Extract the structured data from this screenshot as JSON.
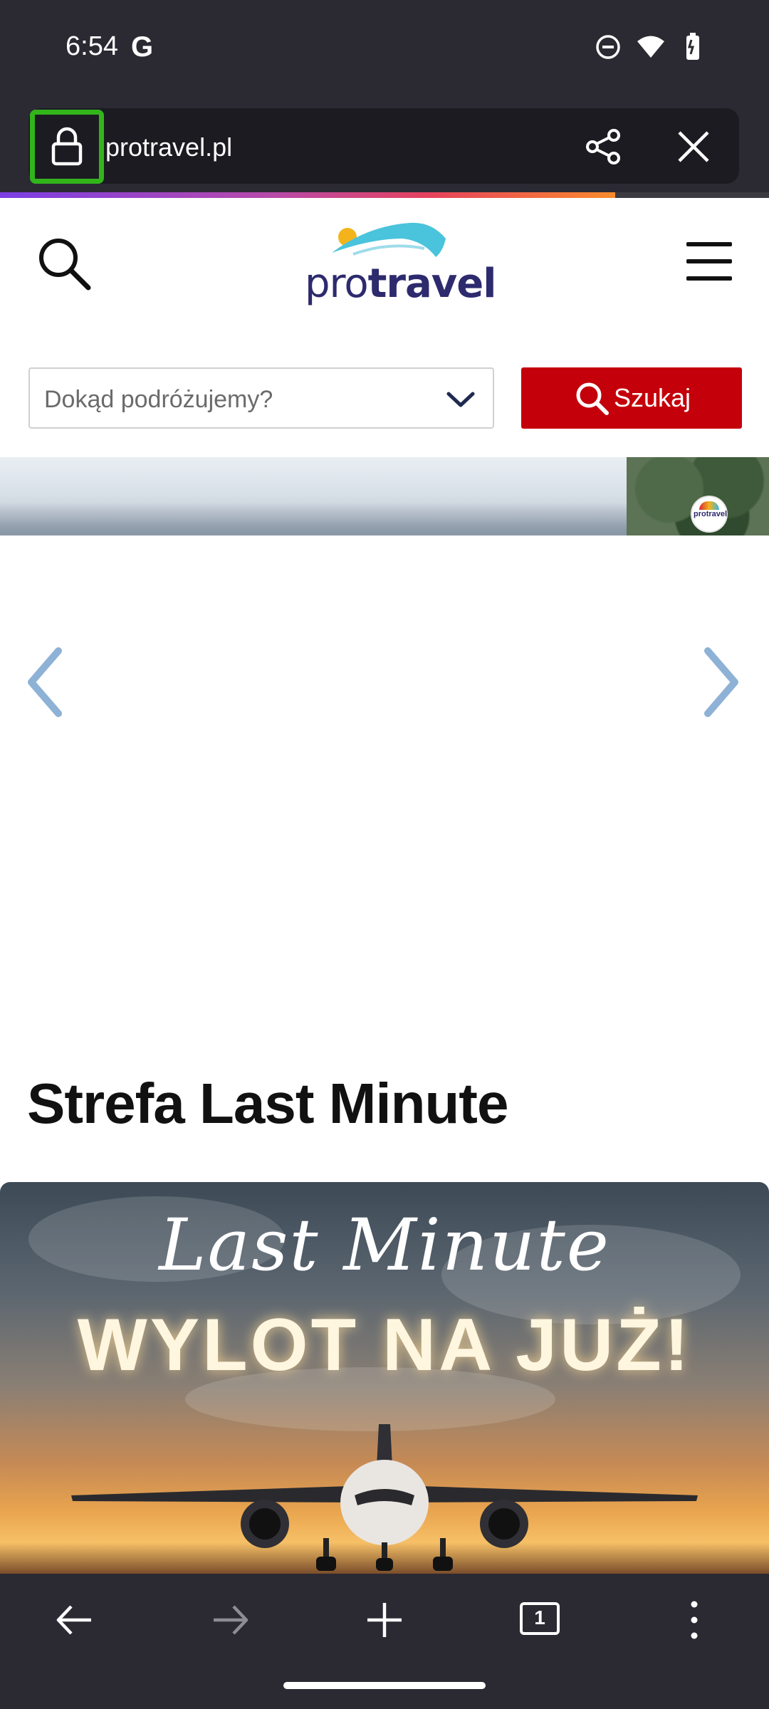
{
  "status_bar": {
    "time": "6:54",
    "google_badge": "G",
    "icons": [
      "do-not-disturb-icon",
      "wifi-icon",
      "battery-icon"
    ]
  },
  "browser": {
    "url": "protravel.pl",
    "load_progress": 0.8,
    "toolbar": {
      "tabs_count": "1",
      "icons": [
        "back-arrow-icon",
        "forward-arrow-icon",
        "new-tab-plus-icon",
        "tabs-counter-icon",
        "more-menu-icon"
      ]
    },
    "accent_colors": {
      "lock_highlight": "#32b41b",
      "chrome_bg": "#2b2a33"
    }
  },
  "site": {
    "logo": {
      "pro": "pro",
      "travel": "travel"
    },
    "search_form": {
      "destination_placeholder": "Dokąd podróżujemy?",
      "search_button_label": "Szukaj",
      "button_color": "#c4000a"
    },
    "hero": {
      "badge_text": "protravel"
    },
    "last_minute": {
      "section_title": "Strefa Last Minute",
      "promo_script": "Last Minute",
      "promo_headline": "WYLOT NA JUŻ!"
    }
  }
}
